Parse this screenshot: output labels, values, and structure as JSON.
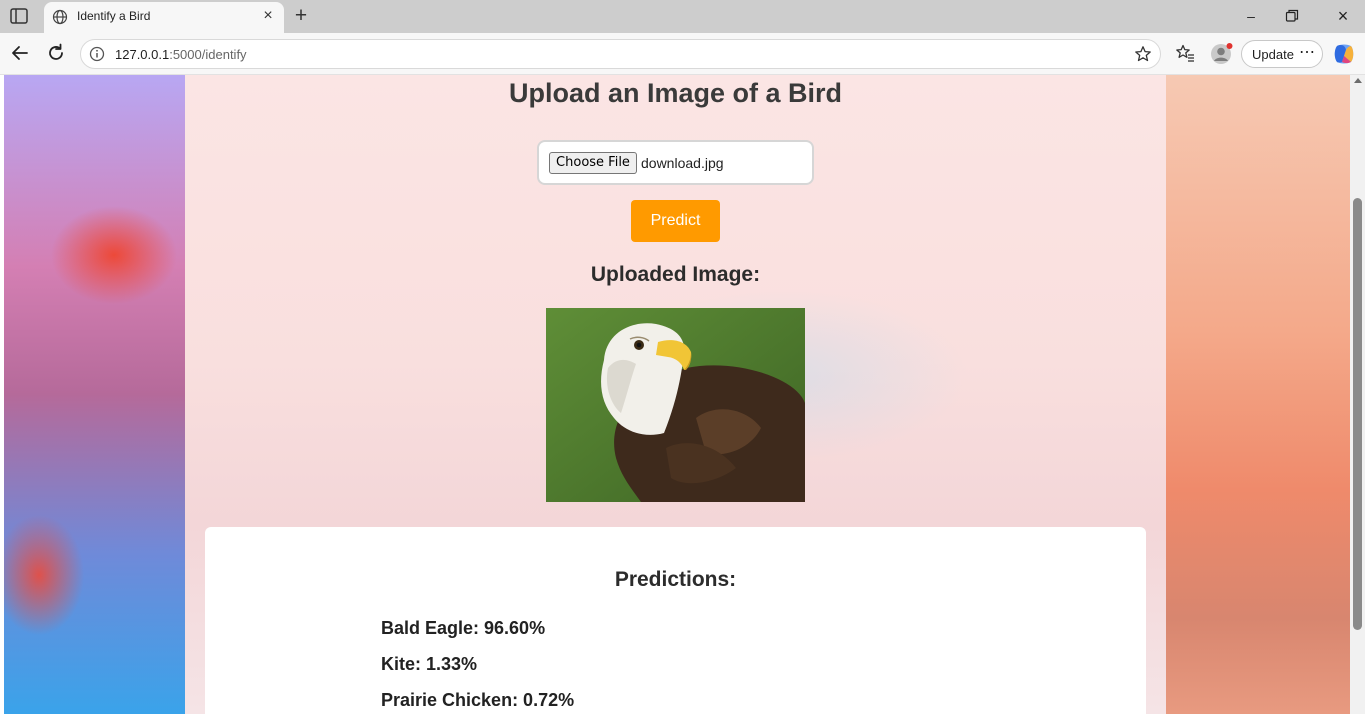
{
  "browser": {
    "tab_title": "Identify a Bird",
    "url_host": "127.0.0.1",
    "url_rest": ":5000/identify",
    "update_label": "Update",
    "more_label": "⋯"
  },
  "page": {
    "heading": "Upload an Image of a Bird",
    "file_input": {
      "button_label": "Choose File",
      "file_name": "download.jpg"
    },
    "predict_label": "Predict",
    "uploaded_heading": "Uploaded Image:",
    "predictions_heading": "Predictions:",
    "predictions": [
      "Bald Eagle: 96.60%",
      "Kite: 1.33%",
      "Prairie Chicken: 0.72%"
    ]
  },
  "colors": {
    "predict_button": "#ff9a00",
    "heading_text": "#3a3a3a"
  },
  "icons": [
    "sidebar-toggle-icon",
    "globe-icon",
    "close-icon",
    "plus-icon",
    "minimize-icon",
    "maximize-icon",
    "back-icon",
    "reload-icon",
    "info-icon",
    "star-icon",
    "favorites-icon",
    "profile-icon",
    "copilot-icon"
  ]
}
